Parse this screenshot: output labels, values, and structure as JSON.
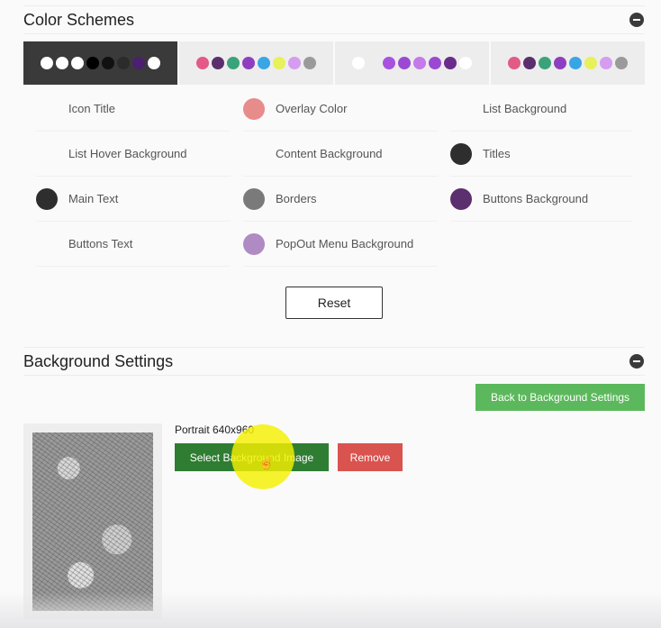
{
  "color_schemes": {
    "title": "Color Schemes",
    "schemes": [
      {
        "selected": true,
        "dots": [
          "#ffffff",
          "#ffffff",
          "#ffffff",
          "#000000",
          "#111111",
          "#2b2b2b",
          "#4b2070",
          "#ffffff"
        ]
      },
      {
        "selected": false,
        "dots": [
          "#e35a86",
          "#5b2f6d",
          "#3aa37a",
          "#8e3fbf",
          "#3aa5e5",
          "#e8f05a",
          "#d59cf0",
          "#9a9a9a"
        ]
      },
      {
        "selected": false,
        "dots": [
          "#ffffff",
          "#ededed",
          "#a852e0",
          "#9b49d3",
          "#c47ae8",
          "#9b49d3",
          "#6a2c8a",
          "#ffffff"
        ]
      },
      {
        "selected": false,
        "dots": [
          "#e35a86",
          "#5b2f6d",
          "#3aa37a",
          "#8e3fbf",
          "#3aa5e5",
          "#e8f05a",
          "#d59cf0",
          "#9a9a9a"
        ]
      }
    ],
    "settings": [
      {
        "label": "Icon Title",
        "color": ""
      },
      {
        "label": "Overlay Color",
        "color": "#e88b8b"
      },
      {
        "label": "List Background",
        "color": ""
      },
      {
        "label": "List Hover Background",
        "color": ""
      },
      {
        "label": "Content Background",
        "color": ""
      },
      {
        "label": "Titles",
        "color": "#2e2e2e"
      },
      {
        "label": "Main Text",
        "color": "#2e2e2e"
      },
      {
        "label": "Borders",
        "color": "#7a7a7a"
      },
      {
        "label": "Buttons Background",
        "color": "#5c2f6e"
      },
      {
        "label": "Buttons Text",
        "color": ""
      },
      {
        "label": "PopOut Menu Background",
        "color": "#b08ac2"
      }
    ],
    "reset_label": "Reset"
  },
  "background_settings": {
    "title": "Background Settings",
    "back_label": "Back to Background Settings",
    "size_label": "Portrait 640x960",
    "select_label": "Select Background Image",
    "remove_label": "Remove"
  },
  "colors": {
    "green": "#5cb85c",
    "dark_green": "#2e7d32",
    "red": "#d9534f"
  }
}
